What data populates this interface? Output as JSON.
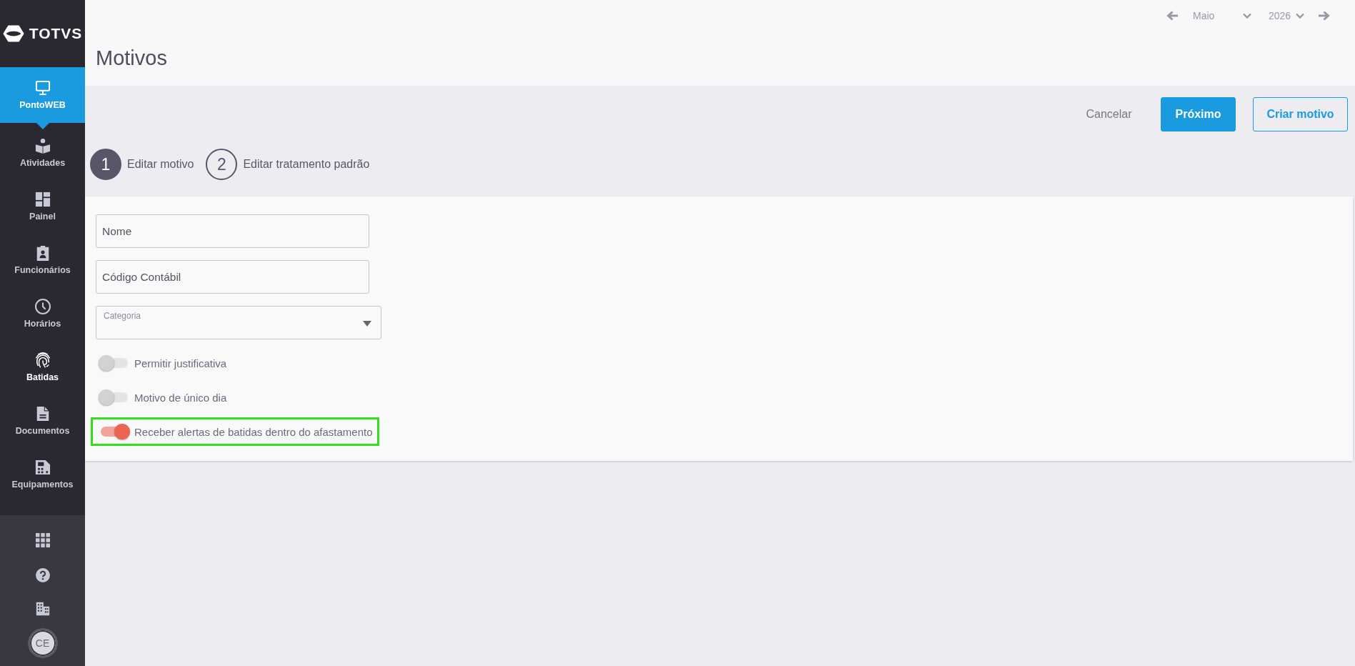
{
  "sidebar": {
    "logo": {
      "text": "TOTVS"
    },
    "items": [
      {
        "label": "PontoWEB",
        "selected": true,
        "hovered": false
      },
      {
        "label": "Atividades",
        "selected": false,
        "hovered": false
      },
      {
        "label": "Painel",
        "selected": false,
        "hovered": false
      },
      {
        "label": "Funcionários",
        "selected": false,
        "hovered": false
      },
      {
        "label": "Horários",
        "selected": false,
        "hovered": false
      },
      {
        "label": "Batidas",
        "selected": false,
        "hovered": true
      },
      {
        "label": "Documentos",
        "selected": false,
        "hovered": false
      },
      {
        "label": "Equipamentos",
        "selected": false,
        "hovered": false
      }
    ],
    "avatar": {
      "initials": "CE"
    }
  },
  "date_nav": {
    "month": "Maio",
    "year": "2026"
  },
  "page": {
    "title": "Motivos"
  },
  "actions": [
    {
      "label": "Cancelar",
      "kind": "text"
    },
    {
      "label": "Próximo",
      "kind": "primary"
    },
    {
      "label": "Criar motivo",
      "kind": "outline"
    }
  ],
  "steps": [
    {
      "number": "1",
      "label": "Editar motivo",
      "selected": true
    },
    {
      "number": "2",
      "label": "Editar tratamento padrão",
      "selected": false
    }
  ],
  "form": {
    "fields": [
      {
        "kind": "text",
        "placeholder": "Nome"
      },
      {
        "kind": "text",
        "placeholder": "Código Contábil"
      },
      {
        "kind": "select",
        "label": "Categoria"
      }
    ],
    "toggles": [
      {
        "label": "Permitir justificativa",
        "on": false,
        "highlighted": false
      },
      {
        "label": "Motivo de único dia",
        "on": false,
        "highlighted": false
      },
      {
        "label": "Receber alertas de batidas dentro do afastamento",
        "on": true,
        "highlighted": true
      }
    ]
  }
}
